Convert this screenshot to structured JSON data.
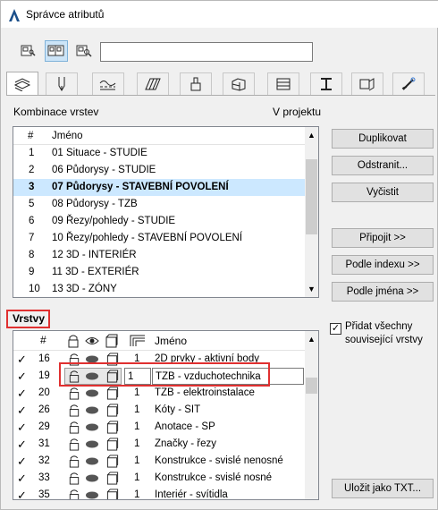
{
  "window": {
    "title": "Správce atributů"
  },
  "toolbar": {
    "search_value": ""
  },
  "tabs": [
    "layers-tab",
    "pens-tab",
    "line-types-tab",
    "fill-types-tab",
    "surfaces-tab",
    "building-materials-tab",
    "profiles-tab",
    "zone-categories-tab",
    "graphic-overrides-tab"
  ],
  "combos": {
    "header": "Kombinace vrstev",
    "in_project": "V projektu",
    "col_num": "#",
    "col_name": "Jméno",
    "rows": [
      {
        "num": "1",
        "name": "01 Situace - STUDIE"
      },
      {
        "num": "2",
        "name": "06 Půdorysy - STUDIE"
      },
      {
        "num": "3",
        "name": "07 Půdorysy - STAVEBNÍ POVOLENÍ"
      },
      {
        "num": "5",
        "name": "08 Půdorysy - TZB"
      },
      {
        "num": "6",
        "name": "09 Řezy/pohledy - STUDIE"
      },
      {
        "num": "7",
        "name": "10 Řezy/pohledy - STAVEBNÍ POVOLENÍ"
      },
      {
        "num": "8",
        "name": "12 3D - INTERIÉR"
      },
      {
        "num": "9",
        "name": "11 3D - EXTERIÉR"
      },
      {
        "num": "10",
        "name": "13 3D - ZÓNY"
      }
    ]
  },
  "buttons": {
    "duplicate": "Duplikovat",
    "remove": "Odstranit...",
    "purge": "Vyčistit",
    "append": "Připojit >>",
    "by_index": "Podle indexu >>",
    "by_name": "Podle jména >>",
    "save_txt": "Uložit jako TXT..."
  },
  "layers": {
    "header": "Vrstvy",
    "col_num": "#",
    "col_name": "Jméno",
    "add_related": "Přidat všechny související vrstvy",
    "add_related_checked": true,
    "rows": [
      {
        "num": "16",
        "pen": "1",
        "name": "2D prvky - aktivní body"
      },
      {
        "num": "19",
        "pen": "1",
        "name": "TZB - vzduchotechnika"
      },
      {
        "num": "20",
        "pen": "1",
        "name": "TZB - elektroinstalace"
      },
      {
        "num": "26",
        "pen": "1",
        "name": "Kóty - SIT"
      },
      {
        "num": "29",
        "pen": "1",
        "name": "Anotace - SP"
      },
      {
        "num": "31",
        "pen": "1",
        "name": "Značky - řezy"
      },
      {
        "num": "32",
        "pen": "1",
        "name": "Konstrukce - svislé nenosné"
      },
      {
        "num": "33",
        "pen": "1",
        "name": "Konstrukce - svislé nosné"
      },
      {
        "num": "35",
        "pen": "1",
        "name": "Interiér - svítidla"
      }
    ]
  }
}
